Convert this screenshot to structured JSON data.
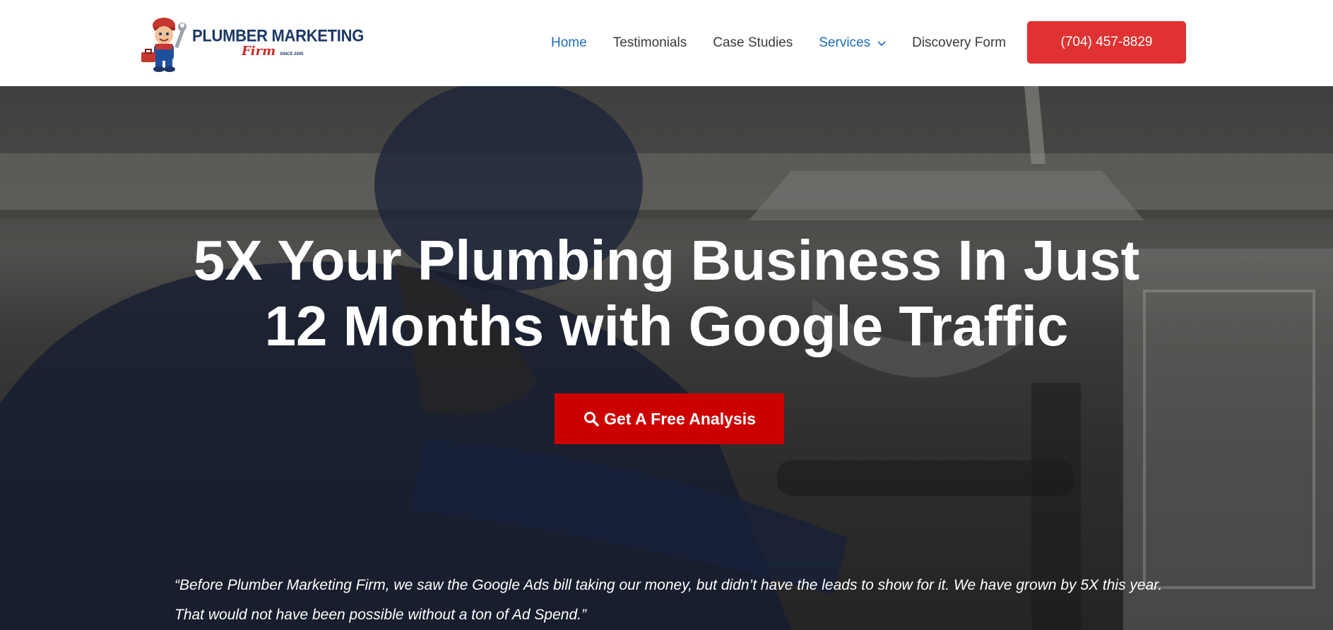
{
  "header": {
    "logo": {
      "line1": "PLUMBER MARKETING",
      "line2": "Firm",
      "since": "SINCE 2005"
    },
    "nav": [
      {
        "label": "Home",
        "active": true
      },
      {
        "label": "Testimonials"
      },
      {
        "label": "Case Studies"
      },
      {
        "label": "Services",
        "has_dropdown": true
      },
      {
        "label": "Discovery Form"
      }
    ],
    "phone_button": "(704) 457-8829"
  },
  "hero": {
    "title_line1": "5X Your Plumbing Business In Just",
    "title_line2": "12 Months with Google Traffic",
    "cta_label": "Get A Free Analysis",
    "cta_icon": "search-icon",
    "quote": "“Before Plumber Marketing Firm, we saw the Google Ads bill taking our money, but didn’t have the leads to show for it. We have grown by 5X this year. That would not have been possible without a ton of Ad Spend.”"
  },
  "colors": {
    "nav_active": "#1e6db8",
    "phone_button": "#e03232",
    "cta_button": "#cc0000",
    "logo_navy": "#1c3766",
    "logo_red": "#cc2a2a"
  }
}
